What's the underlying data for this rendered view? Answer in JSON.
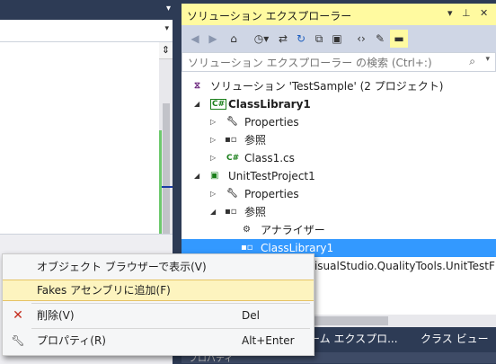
{
  "solution_explorer": {
    "title": "ソリューション エクスプローラー",
    "pin_icon": "pin-icon",
    "search_placeholder": "ソリューション エクスプローラー の検索 (Ctrl+:)",
    "tree": [
      {
        "label": "ソリューション 'TestSample' (2 プロジェクト)",
        "icon": "solution-icon"
      },
      {
        "label": "ClassLibrary1",
        "icon": "csharp-project-icon",
        "bold": true
      },
      {
        "label": "Properties",
        "icon": "wrench-icon"
      },
      {
        "label": "参照",
        "icon": "references-icon"
      },
      {
        "label": "Class1.cs",
        "icon": "csharp-file-icon"
      },
      {
        "label": "UnitTestProject1",
        "icon": "test-project-icon"
      },
      {
        "label": "Properties",
        "icon": "wrench-icon"
      },
      {
        "label": "参照",
        "icon": "references-icon"
      },
      {
        "label": "アナライザー",
        "icon": "analyzer-icon"
      },
      {
        "label": "ClassLibrary1",
        "icon": "reference-icon",
        "selected": true
      },
      {
        "label": "VisualStudio.QualityTools.UnitTestF",
        "icon": "reference-icon"
      }
    ],
    "selection_color": "#3399ff"
  },
  "tabs": [
    {
      "label": "ーム エクスプロ..."
    },
    {
      "label": "クラス ビュー"
    }
  ],
  "properties_panel": {
    "title": "プロパティ"
  },
  "context_menu": {
    "items": [
      {
        "label": "オブジェクト ブラウザーで表示(V)",
        "shortcut": "",
        "icon": ""
      },
      {
        "label": "Fakes アセンブリに追加(F)",
        "shortcut": "",
        "icon": "",
        "highlighted": true
      },
      {
        "label": "削除(V)",
        "shortcut": "Del",
        "icon": "delete-x-icon"
      },
      {
        "label": "プロパティ(R)",
        "shortcut": "Alt+Enter",
        "icon": "wrench-icon"
      }
    ],
    "highlight_color": "#fdf4bf"
  }
}
